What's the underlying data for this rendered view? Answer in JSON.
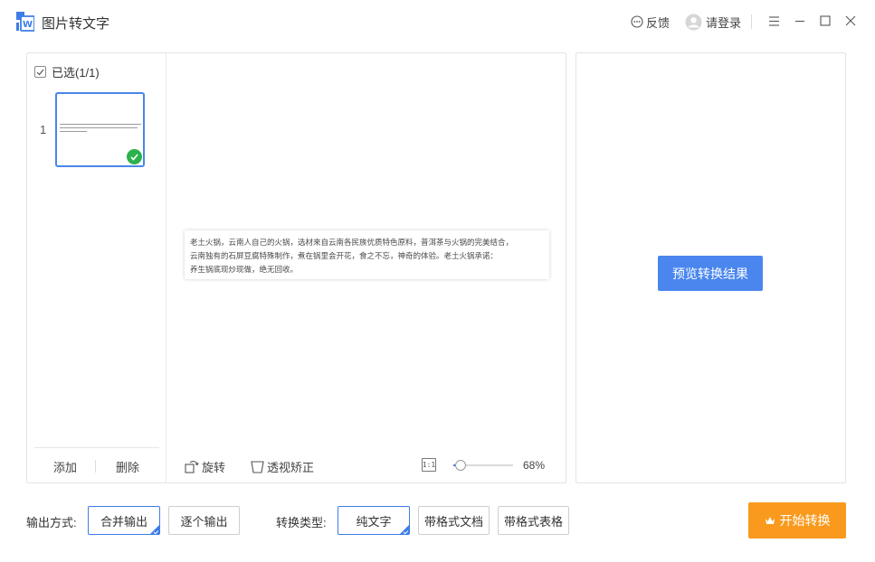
{
  "app": {
    "title": "图片转文字"
  },
  "header": {
    "feedback_label": "反馈",
    "login_label": "请登录"
  },
  "thumbnails": {
    "select_all_label": "已选(1/1)",
    "items": [
      {
        "index": "1"
      }
    ],
    "add_label": "添加",
    "delete_label": "删除"
  },
  "preview": {
    "lines": [
      "老土火锅，云南人自己的火锅，选材来自云南各民族优质特色原料，普洱茶与火锅的完美结合，",
      "云南独有的石屏豆腐特殊制作，煮在锅里会开花，食之不忘，神奇的体验。老土火锅承诺：",
      "养生锅底现炒现做，绝无回收。"
    ],
    "rotate_label": "旋转",
    "perspective_label": "透视矫正",
    "fit_icon_text": "1:1",
    "zoom": 0.68,
    "zoom_label": "68%"
  },
  "result": {
    "preview_button": "预览转换结果"
  },
  "footer": {
    "output_label": "输出方式:",
    "output_options": [
      "合并输出",
      "逐个输出"
    ],
    "output_selected": "合并输出",
    "type_label": "转换类型:",
    "type_options": [
      "纯文字",
      "带格式文档",
      "带格式表格"
    ],
    "type_selected": "纯文字",
    "start_button": "开始转换"
  },
  "colors": {
    "accent": "#4a86ee",
    "start": "#f99a1e",
    "success": "#2db14d"
  },
  "icons": [
    "app-logo-icon",
    "feedback-bubble-icon",
    "user-avatar-icon",
    "menu-icon",
    "minimize-icon",
    "maximize-icon",
    "close-icon",
    "checkbox-check-icon",
    "rotate-icon",
    "perspective-icon",
    "fit-size-icon",
    "crown-icon"
  ]
}
